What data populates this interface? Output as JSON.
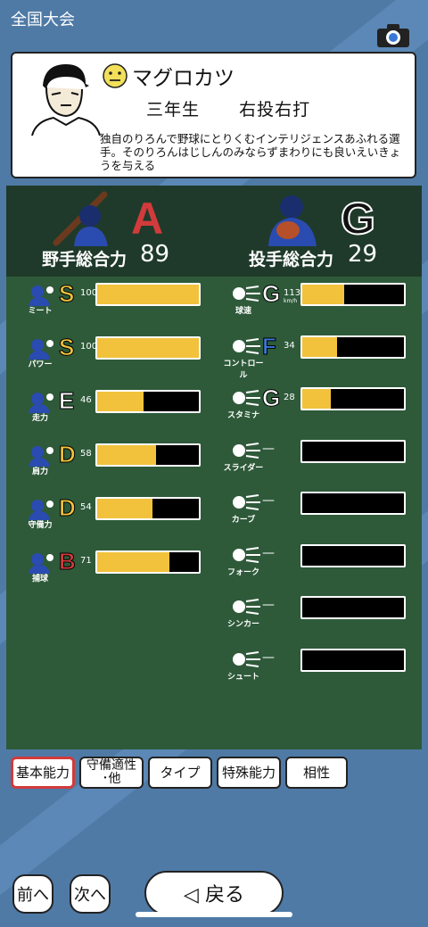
{
  "screen_title": "全国大会",
  "player": {
    "name": "マグロカツ",
    "grade": "三年生",
    "hand": "右投右打",
    "description": "独自のりろんで野球にとりくむインテリジェンスあふれる選手。そのりろんはじしんのみならずまわりにも良いえいきょうを与える"
  },
  "fielder": {
    "label": "野手総合力",
    "rank": "A",
    "value": "89",
    "rank_color": "#d23b3b"
  },
  "pitcher": {
    "label": "投手総合力",
    "rank": "G",
    "value": "29",
    "rank_color": "#111111"
  },
  "rank_colors": {
    "S": "#f2c23c",
    "E": "#ffffff",
    "D": "#f2c23c",
    "B": "#d23b3b",
    "G": "#ffffff",
    "F": "#3a78d8"
  },
  "fielder_stats": [
    {
      "label": "ミート",
      "rank": "S",
      "value": "100",
      "fill": 1.0
    },
    {
      "label": "パワー",
      "rank": "S",
      "value": "100",
      "fill": 1.0
    },
    {
      "label": "走力",
      "rank": "E",
      "value": "46",
      "fill": 0.46
    },
    {
      "label": "肩力",
      "rank": "D",
      "value": "58",
      "fill": 0.58
    },
    {
      "label": "守備力",
      "rank": "D",
      "value": "54",
      "fill": 0.54
    },
    {
      "label": "捕球",
      "rank": "B",
      "value": "71",
      "fill": 0.71
    }
  ],
  "pitcher_stats": [
    {
      "label": "球速",
      "rank": "G",
      "value": "113",
      "unit": "km/h",
      "fill": 0.41
    },
    {
      "label": "コントロール",
      "rank": "F",
      "value": "34",
      "unit": "",
      "fill": 0.34
    },
    {
      "label": "スタミナ",
      "rank": "G",
      "value": "28",
      "unit": "",
      "fill": 0.28
    },
    {
      "label": "スライダー",
      "rank": "",
      "value": "—",
      "unit": "",
      "fill": 0
    },
    {
      "label": "カーブ",
      "rank": "",
      "value": "—",
      "unit": "",
      "fill": 0
    },
    {
      "label": "フォーク",
      "rank": "",
      "value": "—",
      "unit": "",
      "fill": 0
    },
    {
      "label": "シンカー",
      "rank": "",
      "value": "—",
      "unit": "",
      "fill": 0
    },
    {
      "label": "シュート",
      "rank": "",
      "value": "—",
      "unit": "",
      "fill": 0
    }
  ],
  "tabs": [
    "基本能力",
    "守備適性\n･他",
    "タイプ",
    "特殊能力",
    "相性"
  ],
  "nav": {
    "prev": "前へ",
    "next": "次へ",
    "back": "◁ 戻る"
  }
}
